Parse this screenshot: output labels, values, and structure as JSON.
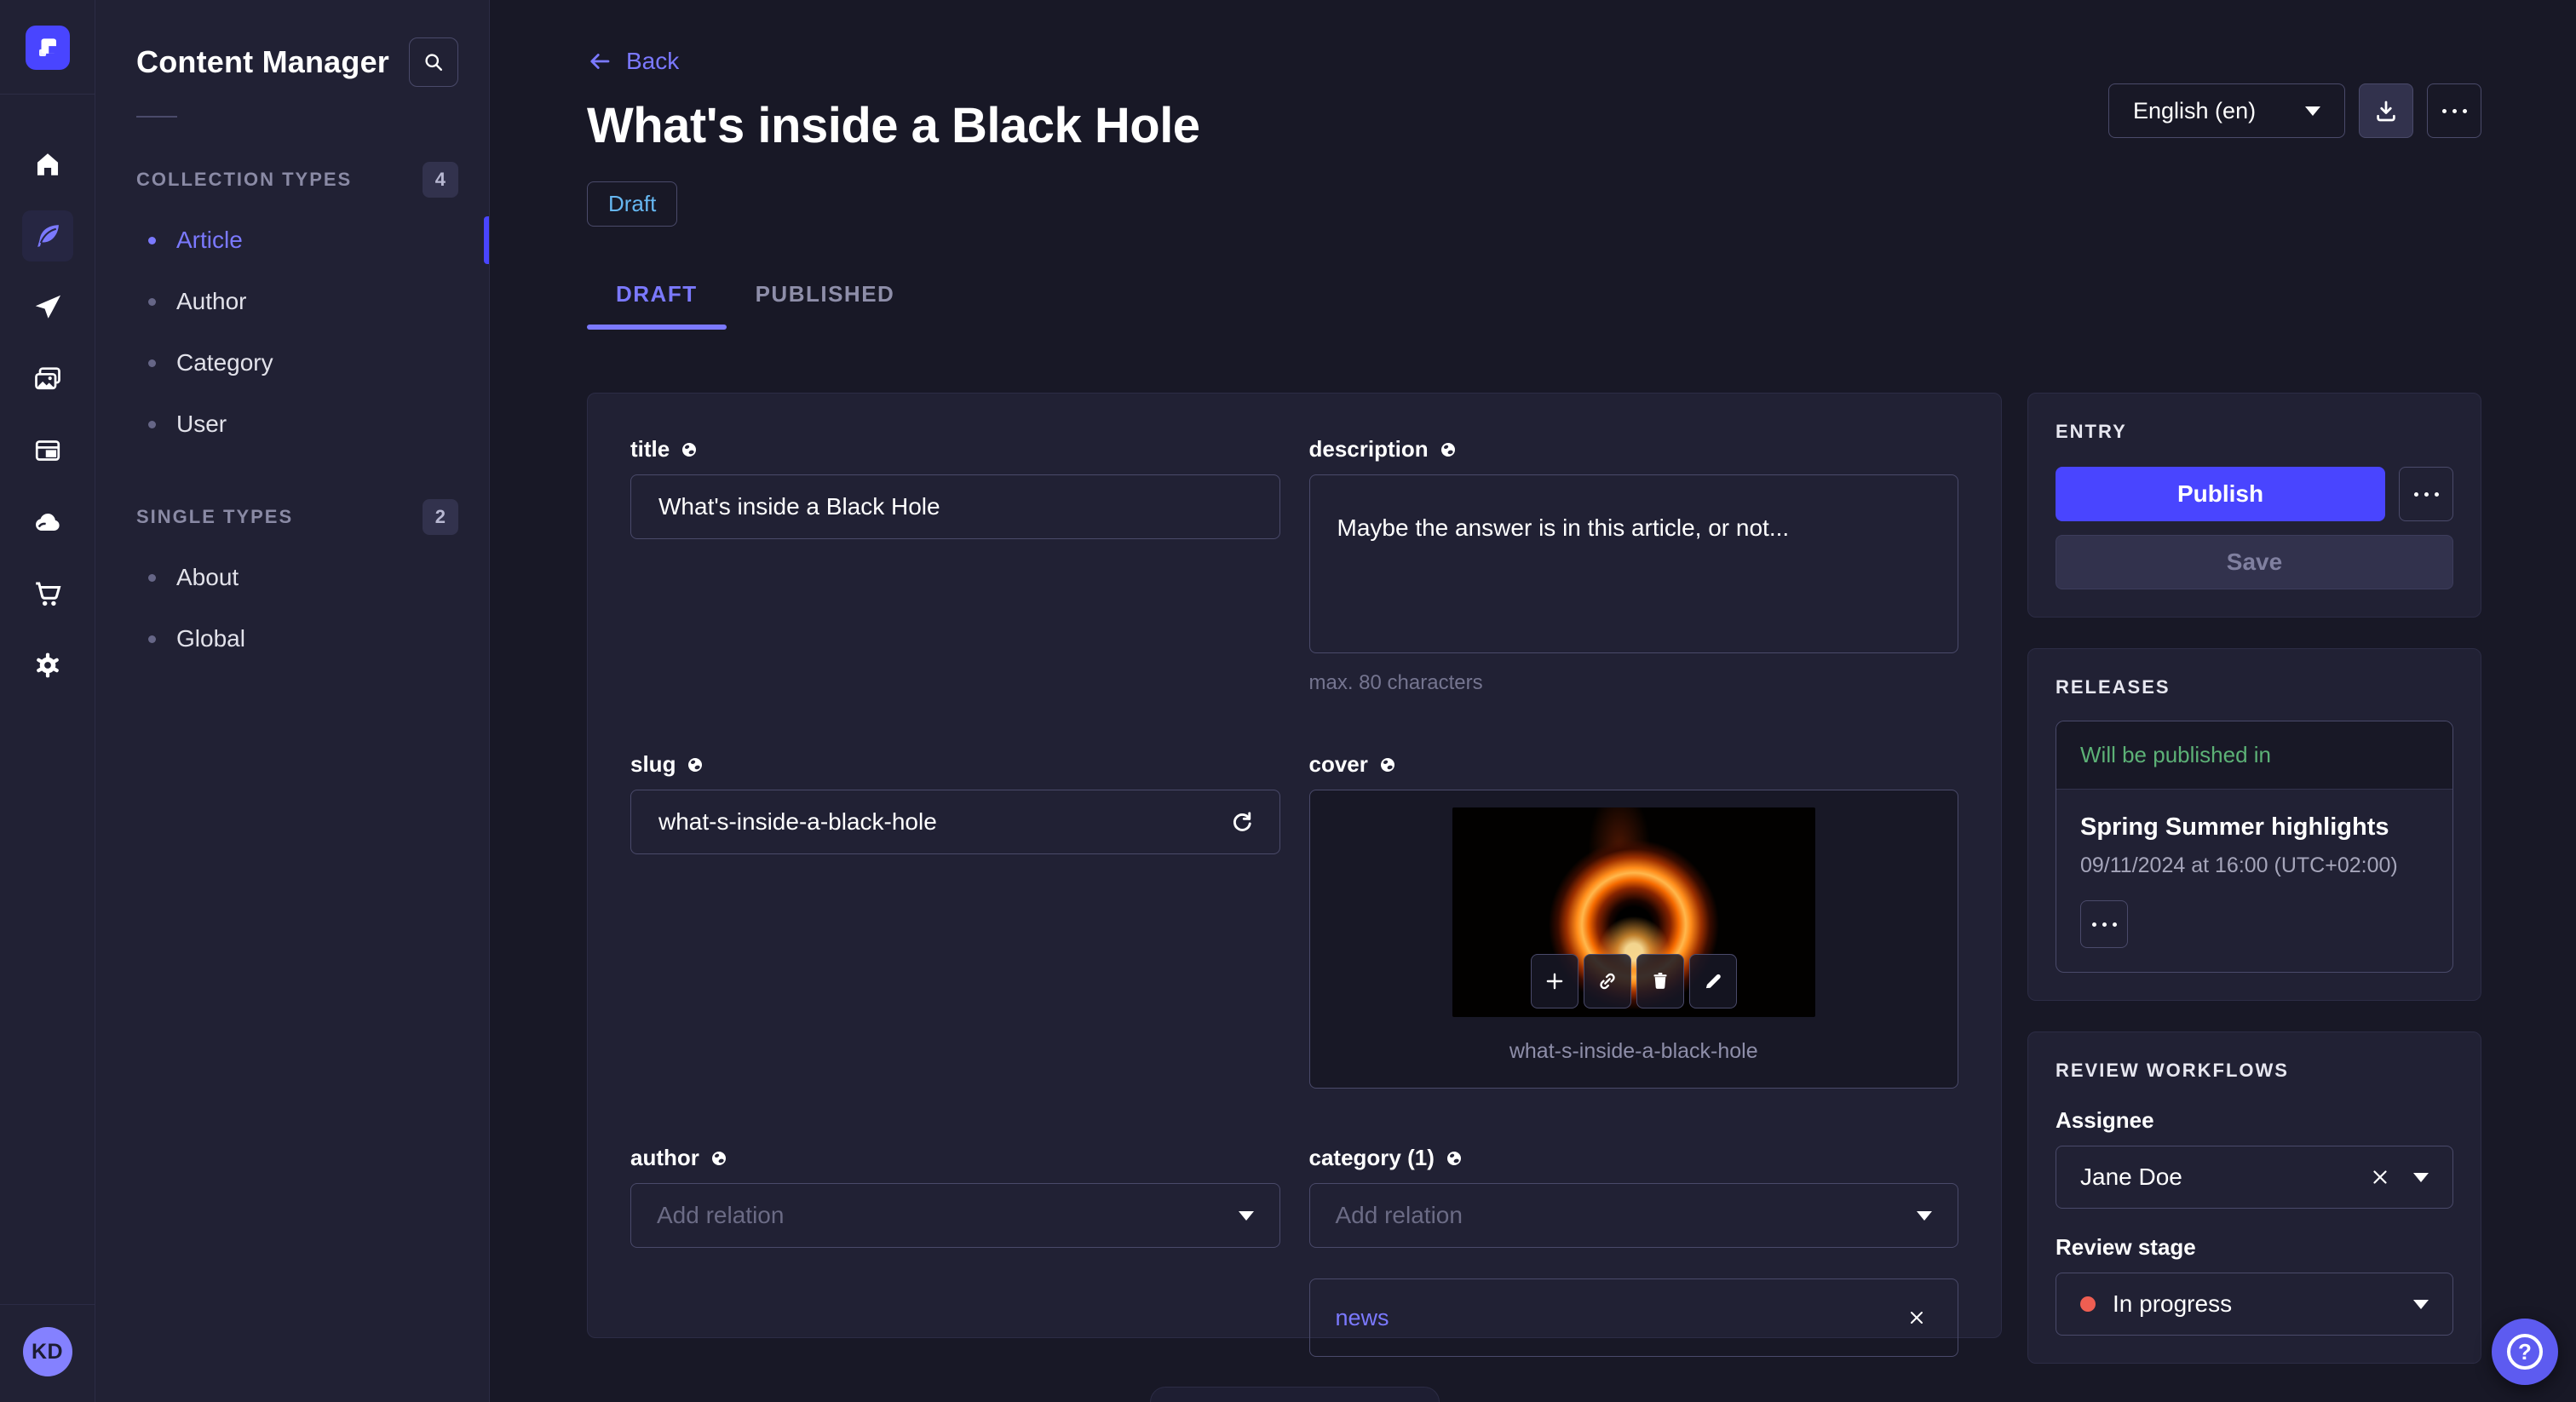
{
  "theme": {
    "accent": "#4945ff",
    "accent_light": "#7b79ff",
    "status_draft": "#66b7f1",
    "status_success": "#5cb176",
    "status_in_progress_dot": "#ee5e52",
    "background": "#181826",
    "panel": "#212134"
  },
  "avatar": {
    "initials": "KD"
  },
  "subnav": {
    "title": "Content Manager",
    "sections": [
      {
        "label": "COLLECTION TYPES",
        "count": "4",
        "items": [
          {
            "label": "Article"
          },
          {
            "label": "Author"
          },
          {
            "label": "Category"
          },
          {
            "label": "User"
          }
        ]
      },
      {
        "label": "SINGLE TYPES",
        "count": "2",
        "items": [
          {
            "label": "About"
          },
          {
            "label": "Global"
          }
        ]
      }
    ]
  },
  "header": {
    "back": "Back",
    "title": "What's inside a Black Hole",
    "status": "Draft",
    "locale": "English (en)"
  },
  "tabs": [
    {
      "label": "DRAFT"
    },
    {
      "label": "PUBLISHED"
    }
  ],
  "form": {
    "title": {
      "label": "title",
      "value": "What's inside a Black Hole"
    },
    "description": {
      "label": "description",
      "value": "Maybe the answer is in this article, or not...",
      "helper": "max. 80 characters"
    },
    "slug": {
      "label": "slug",
      "value": "what-s-inside-a-black-hole"
    },
    "cover": {
      "label": "cover",
      "filename": "what-s-inside-a-black-hole"
    },
    "author": {
      "label": "author",
      "placeholder": "Add relation"
    },
    "category": {
      "label": "category (1)",
      "placeholder": "Add relation",
      "relations": [
        "news"
      ]
    }
  },
  "entry_panel": {
    "title": "ENTRY",
    "publish": "Publish",
    "save": "Save"
  },
  "releases_panel": {
    "title": "RELEASES",
    "status": "Will be published in",
    "release_name": "Spring Summer highlights",
    "release_date": "09/11/2024 at 16:00 (UTC+02:00)"
  },
  "review_panel": {
    "title": "REVIEW WORKFLOWS",
    "assignee_label": "Assignee",
    "assignee_value": "Jane Doe",
    "stage_label": "Review stage",
    "stage_value": "In progress"
  }
}
